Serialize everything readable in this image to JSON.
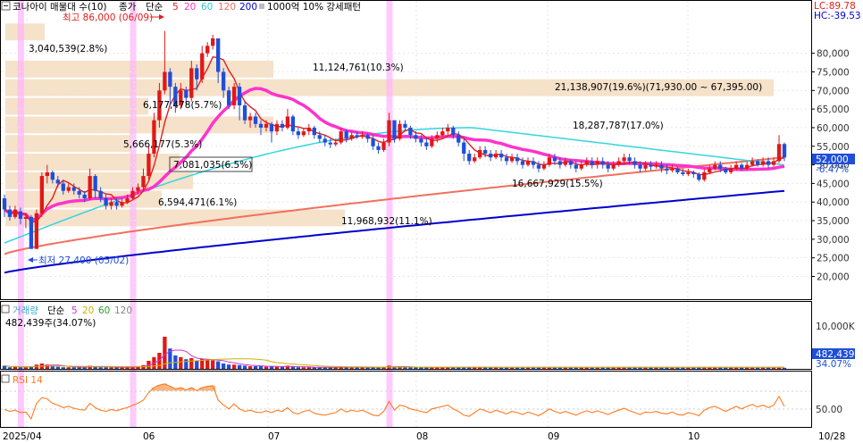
{
  "header": {
    "name": "코나아이 매물대 수(10)",
    "price_ma_label": "종가",
    "ma_type": "단순",
    "ma_periods": [
      "5",
      "20",
      "60",
      "120",
      "200"
    ],
    "pattern_label": "1000억 10% 강세패턴"
  },
  "colors": {
    "ma5": "#e02020",
    "ma20": "#ff33cc",
    "ma60": "#33d6e0",
    "ma120": "#f07060",
    "ma200": "#0000cc",
    "up": "#e01818",
    "down": "#1f4fd8",
    "zone": "#f5dcc0",
    "pattern": "#ffb3ff",
    "rsi": "#ff7a1f"
  },
  "price_axis": {
    "ticks": [
      "80,000",
      "75,000",
      "70,000",
      "65,000",
      "60,000",
      "55,000",
      "50,000",
      "45,000",
      "40,000",
      "35,000",
      "30,000",
      "25,000",
      "20,000"
    ],
    "lc_label": "LC:89.78",
    "hc_label": "HC:-39.53",
    "current_price": "52,000",
    "current_change": "-6.47%"
  },
  "annotations": {
    "high": "최고 86,000 (06/09)",
    "low": "최저 27,400 (05/02)"
  },
  "volume_profile": [
    {
      "label": "3,040,539(2.8%)"
    },
    {
      "label": "11,124,761(10.3%)"
    },
    {
      "label": "21,138,907(19.6%)(71,930.00 ~ 67,395.00)"
    },
    {
      "label": "6,177,478(5.7%)"
    },
    {
      "label": "18,287,787(17.0%)"
    },
    {
      "label": "5,666,177(5.3%)"
    },
    {
      "label": "7,081,035(6.5%)"
    },
    {
      "label": "16,667,929(15.5%)"
    },
    {
      "label": "6,594,471(6.1%)"
    },
    {
      "label": "11,968,932(11.1%)"
    }
  ],
  "volume_panel": {
    "title": "거래량",
    "ma_type": "단순",
    "ma_periods": [
      "5",
      "20",
      "60",
      "120"
    ],
    "current": "482,439주(34.07%)",
    "axis_tick": "10,000K",
    "current_value": "482,439",
    "current_pct": "34.07%"
  },
  "rsi_panel": {
    "title": "RSI 14",
    "axis_tick": "50.00"
  },
  "x_axis": {
    "labels": [
      "2025/04",
      "06",
      "07",
      "08",
      "09",
      "10",
      "10/28"
    ]
  },
  "chart_data": {
    "type": "candlestick",
    "y_range": [
      17000,
      90000
    ],
    "pattern_days": [
      3,
      24,
      72
    ],
    "candles": [
      [
        41000,
        38000,
        42000,
        36000
      ],
      [
        38000,
        36000,
        39000,
        35000
      ],
      [
        36000,
        38000,
        39000,
        35500
      ],
      [
        37500,
        35500,
        38500,
        34000
      ],
      [
        35500,
        36000,
        37000,
        33000
      ],
      [
        36000,
        27400,
        36500,
        27400
      ],
      [
        27400,
        37000,
        38000,
        27400
      ],
      [
        37000,
        47000,
        48000,
        36000
      ],
      [
        47000,
        48000,
        50000,
        45000
      ],
      [
        48000,
        46000,
        48500,
        45000
      ],
      [
        46000,
        45000,
        47000,
        44000
      ],
      [
        45000,
        43000,
        46000,
        42000
      ],
      [
        43000,
        44000,
        45000,
        42500
      ],
      [
        44000,
        43000,
        45000,
        42000
      ],
      [
        43000,
        42000,
        44000,
        41000
      ],
      [
        42000,
        41000,
        43000,
        40000
      ],
      [
        41000,
        47000,
        49000,
        40500
      ],
      [
        47000,
        43000,
        47500,
        41000
      ],
      [
        43000,
        41000,
        44000,
        40000
      ],
      [
        41000,
        39000,
        42000,
        38000
      ],
      [
        39000,
        40000,
        41000,
        38000
      ],
      [
        40000,
        39000,
        41000,
        38000
      ],
      [
        39000,
        40000,
        41000,
        38500
      ],
      [
        40000,
        41000,
        42000,
        39500
      ],
      [
        41000,
        43000,
        44000,
        40500
      ],
      [
        43000,
        44000,
        45000,
        42000
      ],
      [
        44000,
        47000,
        49000,
        43000
      ],
      [
        47000,
        53000,
        55000,
        46000
      ],
      [
        53000,
        62000,
        64000,
        52000
      ],
      [
        62000,
        70000,
        72000,
        60000
      ],
      [
        70000,
        75000,
        86000,
        69000
      ],
      [
        75000,
        71000,
        76000,
        66000
      ],
      [
        71000,
        66000,
        72000,
        64000
      ],
      [
        66000,
        70000,
        72000,
        65000
      ],
      [
        70000,
        68000,
        71000,
        66000
      ],
      [
        68000,
        76000,
        78000,
        67000
      ],
      [
        76000,
        73000,
        77000,
        70000
      ],
      [
        73000,
        80000,
        82000,
        72000
      ],
      [
        80000,
        82000,
        83000,
        79000
      ],
      [
        82000,
        84000,
        85000,
        81000
      ],
      [
        84000,
        75000,
        84000,
        72000
      ],
      [
        75000,
        70000,
        76000,
        68000
      ],
      [
        70000,
        66000,
        71000,
        65000
      ],
      [
        66000,
        71000,
        72000,
        65000
      ],
      [
        71000,
        66000,
        72000,
        62000
      ],
      [
        66000,
        62000,
        67000,
        61000
      ],
      [
        62000,
        63000,
        64000,
        60000
      ],
      [
        63000,
        61000,
        64000,
        60000
      ],
      [
        61000,
        60000,
        62000,
        58000
      ],
      [
        60000,
        61000,
        62000,
        59000
      ],
      [
        61000,
        59000,
        61500,
        56000
      ],
      [
        59000,
        61000,
        62000,
        58000
      ],
      [
        61000,
        60000,
        62000,
        59000
      ],
      [
        60000,
        63000,
        65000,
        59500
      ],
      [
        63000,
        59000,
        63500,
        58000
      ],
      [
        59000,
        58000,
        60000,
        57000
      ],
      [
        58000,
        59000,
        60000,
        57500
      ],
      [
        59000,
        60000,
        61000,
        58000
      ],
      [
        60000,
        58000,
        60500,
        57000
      ],
      [
        58000,
        57000,
        59000,
        56000
      ],
      [
        57000,
        56000,
        58000,
        55000
      ],
      [
        56000,
        55500,
        57000,
        54500
      ],
      [
        55500,
        56000,
        57000,
        55000
      ],
      [
        56000,
        59000,
        60000,
        55500
      ],
      [
        59000,
        57000,
        59500,
        56000
      ],
      [
        57000,
        58000,
        59000,
        56500
      ],
      [
        58000,
        57500,
        59000,
        57000
      ],
      [
        57500,
        58000,
        59000,
        57000
      ],
      [
        58000,
        57000,
        58500,
        56000
      ],
      [
        57000,
        55000,
        58000,
        54000
      ],
      [
        55000,
        54000,
        56000,
        53000
      ],
      [
        54000,
        56000,
        57000,
        53500
      ],
      [
        56000,
        62000,
        64000,
        55000
      ],
      [
        62000,
        57000,
        62000,
        56000
      ],
      [
        57000,
        61000,
        62000,
        56500
      ],
      [
        61000,
        60000,
        62000,
        59000
      ],
      [
        60000,
        58000,
        60500,
        57000
      ],
      [
        58000,
        57000,
        59000,
        56000
      ],
      [
        57000,
        56000,
        58000,
        55000
      ],
      [
        56000,
        55000,
        57000,
        54000
      ],
      [
        55000,
        57000,
        58000,
        54500
      ],
      [
        57000,
        58000,
        59000,
        56000
      ],
      [
        58000,
        59000,
        60000,
        57500
      ],
      [
        59000,
        60000,
        61000,
        58000
      ],
      [
        60000,
        58000,
        60500,
        57000
      ],
      [
        58000,
        56000,
        59000,
        55000
      ],
      [
        56000,
        53000,
        57000,
        51000
      ],
      [
        53000,
        51000,
        54000,
        50000
      ],
      [
        51000,
        52000,
        53000,
        50500
      ],
      [
        52000,
        54000,
        55000,
        51500
      ],
      [
        54000,
        53000,
        55000,
        52000
      ],
      [
        53000,
        52000,
        54000,
        51000
      ],
      [
        52000,
        53000,
        54000,
        51500
      ],
      [
        53000,
        52000,
        54000,
        51000
      ],
      [
        52000,
        51000,
        53000,
        50000
      ],
      [
        51000,
        52000,
        53000,
        50500
      ],
      [
        52000,
        51000,
        53000,
        50000
      ],
      [
        51000,
        50000,
        52000,
        49000
      ],
      [
        50000,
        51000,
        52000,
        49500
      ],
      [
        51000,
        50000,
        52000,
        49000
      ],
      [
        50000,
        49000,
        51000,
        48000
      ],
      [
        49000,
        50000,
        51000,
        48500
      ],
      [
        50000,
        52000,
        53000,
        49500
      ],
      [
        52000,
        51000,
        53000,
        50000
      ],
      [
        51000,
        50000,
        52000,
        49000
      ],
      [
        50000,
        51000,
        52000,
        49500
      ],
      [
        51000,
        50000,
        51500,
        49000
      ],
      [
        50000,
        49000,
        51000,
        48000
      ],
      [
        49000,
        50000,
        51000,
        48500
      ],
      [
        50000,
        51000,
        52000,
        49500
      ],
      [
        51000,
        50000,
        52000,
        49000
      ],
      [
        50000,
        51000,
        52000,
        49000
      ],
      [
        51000,
        50000,
        52000,
        49000
      ],
      [
        50000,
        49000,
        51000,
        48000
      ],
      [
        49000,
        50000,
        51000,
        48500
      ],
      [
        50000,
        51000,
        52000,
        49500
      ],
      [
        51000,
        52000,
        53000,
        50000
      ],
      [
        52000,
        51000,
        53000,
        50000
      ],
      [
        51000,
        50000,
        52000,
        49000
      ],
      [
        50000,
        49000,
        51000,
        48000
      ],
      [
        49000,
        50000,
        51000,
        48500
      ],
      [
        50000,
        49500,
        51000,
        48500
      ],
      [
        49500,
        50000,
        51000,
        49000
      ],
      [
        50000,
        49000,
        51000,
        48000
      ],
      [
        49000,
        48500,
        50000,
        47500
      ],
      [
        48500,
        49000,
        50000,
        48000
      ],
      [
        49000,
        48000,
        49500,
        47500
      ],
      [
        48000,
        47500,
        49000,
        47000
      ],
      [
        47500,
        48000,
        49000,
        47000
      ],
      [
        48000,
        47500,
        48500,
        46500
      ],
      [
        47500,
        46000,
        48000,
        45500
      ],
      [
        46000,
        48000,
        49000,
        45500
      ],
      [
        48000,
        49000,
        50000,
        47500
      ],
      [
        49000,
        50000,
        51000,
        48500
      ],
      [
        50000,
        49000,
        51000,
        48000
      ],
      [
        49000,
        48000,
        49500,
        47500
      ],
      [
        48000,
        49000,
        50000,
        47500
      ],
      [
        49000,
        50000,
        51000,
        48500
      ],
      [
        50000,
        49000,
        50500,
        48500
      ],
      [
        49000,
        50000,
        51000,
        48500
      ],
      [
        50000,
        51000,
        52000,
        49500
      ],
      [
        51000,
        50000,
        51500,
        49500
      ],
      [
        50000,
        51000,
        52000,
        49500
      ],
      [
        51000,
        50000,
        52000,
        49000
      ],
      [
        50000,
        51000,
        52000,
        49500
      ],
      [
        51000,
        55600,
        58000,
        50500
      ],
      [
        55600,
        52000,
        56000,
        51000
      ]
    ],
    "volume_pct": [
      6,
      3,
      4,
      3,
      3,
      5,
      8,
      10,
      8,
      5,
      4,
      3,
      3,
      3,
      4,
      3,
      6,
      4,
      3,
      3,
      3,
      3,
      3,
      3,
      4,
      5,
      7,
      15,
      22,
      30,
      60,
      38,
      25,
      22,
      18,
      20,
      15,
      19,
      17,
      16,
      14,
      10,
      8,
      8,
      7,
      6,
      5,
      5,
      5,
      4,
      5,
      4,
      4,
      6,
      4,
      3,
      3,
      3,
      3,
      3,
      3,
      3,
      3,
      4,
      3,
      3,
      3,
      3,
      3,
      3,
      3,
      4,
      6,
      4,
      4,
      3,
      3,
      3,
      3,
      3,
      3,
      3,
      3,
      3,
      3,
      3,
      3,
      3,
      3,
      3,
      3,
      3,
      3,
      3,
      3,
      3,
      3,
      3,
      3,
      3,
      3,
      3,
      3,
      3,
      3,
      3,
      3,
      3,
      3,
      3,
      3,
      3,
      3,
      3,
      3,
      3,
      3,
      3,
      3,
      3,
      3,
      3,
      3,
      3,
      3,
      3,
      3,
      3,
      3,
      3,
      3,
      3,
      3,
      3,
      3,
      3,
      3,
      3,
      3,
      3,
      3,
      3,
      3,
      3,
      3,
      3,
      2
    ],
    "rsi": [
      45,
      42,
      44,
      40,
      41,
      30,
      55,
      64,
      62,
      55,
      52,
      48,
      50,
      47,
      45,
      44,
      55,
      48,
      44,
      42,
      45,
      43,
      46,
      48,
      52,
      55,
      60,
      72,
      80,
      84,
      86,
      82,
      78,
      80,
      76,
      80,
      75,
      80,
      82,
      83,
      60,
      52,
      46,
      54,
      46,
      42,
      44,
      41,
      40,
      43,
      40,
      44,
      42,
      48,
      40,
      38,
      42,
      44,
      39,
      37,
      36,
      38,
      40,
      46,
      41,
      44,
      42,
      44,
      40,
      36,
      35,
      42,
      58,
      44,
      52,
      50,
      46,
      44,
      42,
      40,
      46,
      48,
      50,
      52,
      46,
      42,
      36,
      34,
      40,
      46,
      43,
      40,
      44,
      41,
      38,
      42,
      40,
      37,
      41,
      38,
      35,
      40,
      46,
      42,
      39,
      42,
      39,
      36,
      40,
      43,
      40,
      43,
      40,
      37,
      41,
      44,
      47,
      43,
      40,
      37,
      41,
      40,
      42,
      39,
      38,
      41,
      37,
      36,
      40,
      38,
      35,
      44,
      48,
      50,
      46,
      42,
      46,
      50,
      46,
      50,
      53,
      49,
      52,
      48,
      52,
      66,
      50
    ]
  }
}
